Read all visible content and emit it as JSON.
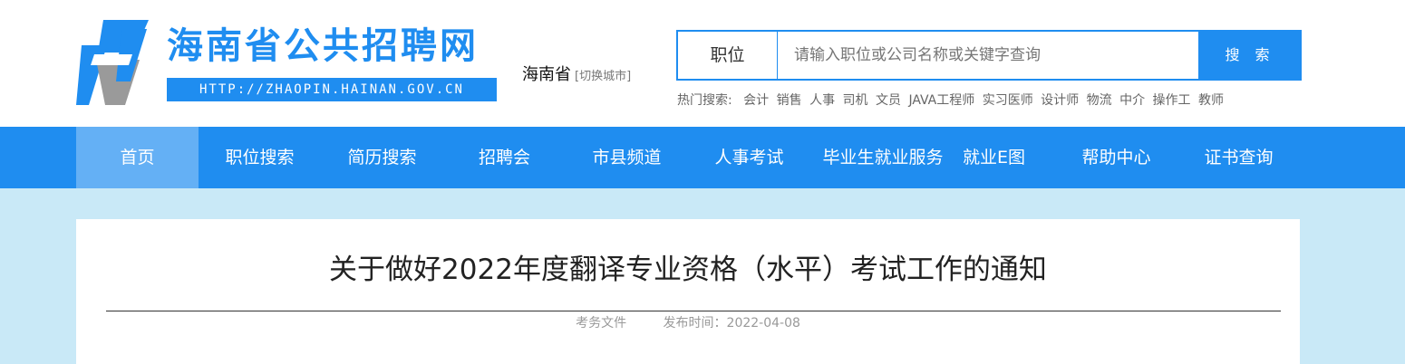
{
  "site": {
    "title": "海南省公共招聘网",
    "url": "HTTP://ZHAOPIN.HAINAN.GOV.CN",
    "logo_icon": "h-logo-icon",
    "brand_color": "#1f8df0"
  },
  "location": {
    "city": "海南省",
    "switch_label": "[切换城市]"
  },
  "search": {
    "category": "职位",
    "placeholder": "请输入职位或公司名称或关键字查询",
    "button_label": "搜 索"
  },
  "hot_search": {
    "label": "热门搜索:",
    "items": [
      "会计",
      "销售",
      "人事",
      "司机",
      "文员",
      "JAVA工程师",
      "实习医师",
      "设计师",
      "物流",
      "中介",
      "操作工",
      "教师"
    ]
  },
  "nav": {
    "items": [
      {
        "label": "首页",
        "active": true
      },
      {
        "label": "职位搜索"
      },
      {
        "label": "简历搜索"
      },
      {
        "label": "招聘会"
      },
      {
        "label": "市县频道"
      },
      {
        "label": "人事考试"
      },
      {
        "label": "毕业生就业服务"
      },
      {
        "label": "就业E图"
      },
      {
        "label": "帮助中心"
      },
      {
        "label": "证书查询"
      }
    ]
  },
  "article": {
    "title": "关于做好2022年度翻译专业资格（水平）考试工作的通知",
    "category": "考务文件",
    "publish_time": "发布时间：2022-04-08"
  }
}
